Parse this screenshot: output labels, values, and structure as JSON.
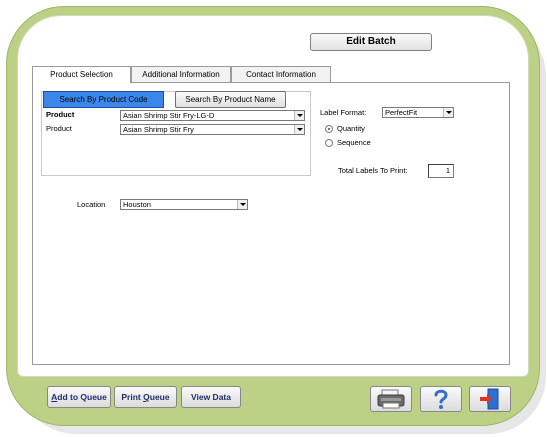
{
  "header": {
    "edit_batch_label": "Edit Batch"
  },
  "tabs": [
    {
      "label": "Product Selection",
      "active": true
    },
    {
      "label": "Additional Information",
      "active": false
    },
    {
      "label": "Contact Information",
      "active": false
    }
  ],
  "product_selection": {
    "search_by_code_label": "Search By Product Code",
    "search_by_name_label": "Search By Product Name",
    "rows": [
      {
        "label": "Product",
        "value": "Asian Shrimp Stir Fry-LG-D"
      },
      {
        "label": "Product",
        "value": "Asian Shrimp Stir Fry"
      }
    ]
  },
  "label_options": {
    "format_label": "Label Format:",
    "format_value": "PerfectFit",
    "quantity_label": "Quantity",
    "sequence_label": "Sequence",
    "selected_mode": "Quantity",
    "total_labels_label": "Total Labels To Print:",
    "total_labels_value": "1"
  },
  "location": {
    "label": "Location",
    "value": "Houston"
  },
  "footer": {
    "add_to_queue_pre": "",
    "add_to_queue_ul": "A",
    "add_to_queue_post": "dd to Queue",
    "print_queue_pre": "Print ",
    "print_queue_ul": "Q",
    "print_queue_post": "ueue",
    "view_data_label": "View Data",
    "icons": [
      "printer-icon",
      "help-icon",
      "exit-door-icon"
    ]
  },
  "colors": {
    "frame": "#bcd086",
    "selected_button": "#3a86ea",
    "button_text": "#1f2f6b"
  }
}
